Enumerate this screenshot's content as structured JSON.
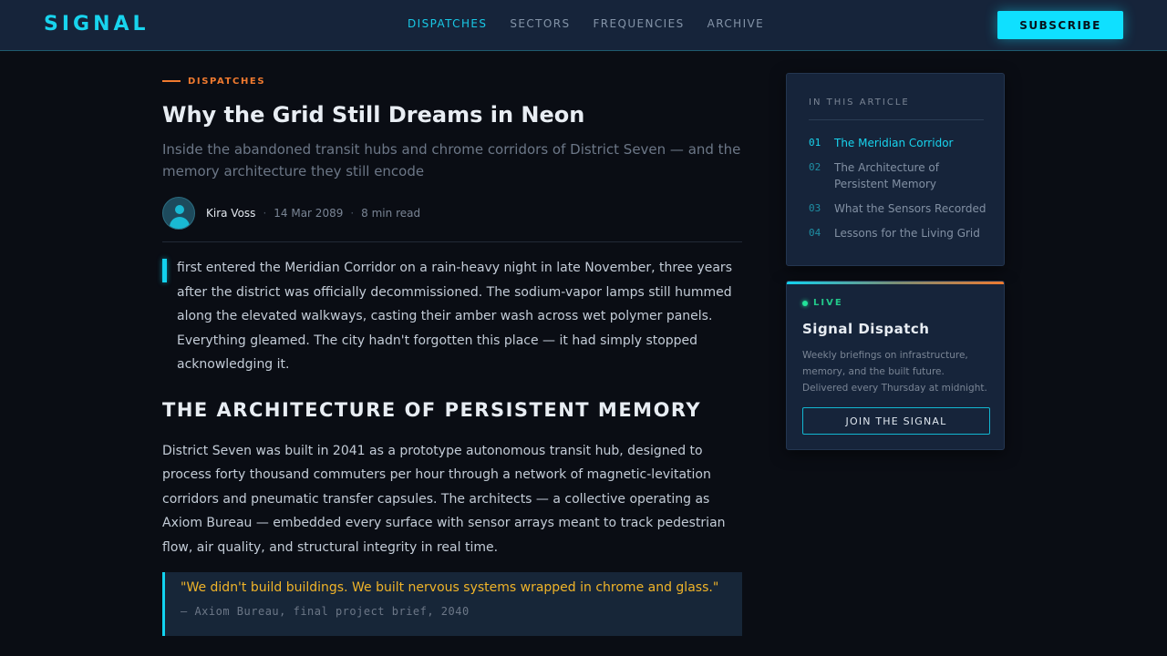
{
  "header": {
    "logo": "SIGNAL",
    "nav": [
      "DISPATCHES",
      "SECTORS",
      "FREQUENCIES",
      "ARCHIVE"
    ],
    "active_nav": "DISPATCHES",
    "subscribe_label": "SUBSCRIBE"
  },
  "article": {
    "kicker": "DISPATCHES",
    "title": "Why the Grid Still Dreams in Neon",
    "dek": "Inside the abandoned transit hubs and chrome corridors of District Seven — and the memory architecture they still encode",
    "author": "Kira Voss",
    "date": "14 Mar 2089",
    "read_time": "8 min read",
    "lead_paragraph": "first entered the Meridian Corridor on a rain-heavy night in late November, three years after the district was officially decommissioned. The sodium-vapor lamps still hummed along the elevated walkways, casting their amber wash across wet polymer panels. Everything gleamed. The city hadn't forgotten this place — it had simply stopped acknowledging it.",
    "section_heading": "THE ARCHITECTURE OF PERSISTENT MEMORY",
    "paragraph_2": "District Seven was built in 2041 as a prototype autonomous transit hub, designed to process forty thousand commuters per hour through a network of magnetic-levitation corridors and pneumatic transfer capsules. The architects — a collective operating as Axiom Bureau — embedded every surface with sensor arrays meant to track pedestrian flow, air quality, and structural integrity in real time.",
    "quote": "\"We didn't build buildings. We built nervous systems wrapped in chrome and glass.\"",
    "quote_source": "— Axiom Bureau, final project brief, 2040"
  },
  "toc": {
    "label": "IN THIS ARTICLE",
    "items": [
      {
        "num": "01",
        "title": "The Meridian Corridor",
        "active": true
      },
      {
        "num": "02",
        "title": "The Architecture of Persistent Memory",
        "active": false
      },
      {
        "num": "03",
        "title": "What the Sensors Recorded",
        "active": false
      },
      {
        "num": "04",
        "title": "Lessons for the Living Grid",
        "active": false
      }
    ]
  },
  "newsletter": {
    "status": "LIVE",
    "heading": "Signal Dispatch",
    "description": "Weekly briefings on infrastructure, memory, and the built future. Delivered every Thursday at midnight.",
    "button_label": "JOIN THE SIGNAL"
  },
  "colors": {
    "accent_cyan": "#12d2ef",
    "accent_orange": "#f07a2f",
    "quote_gold": "#f0b429",
    "live_green": "#22e39a",
    "background": "#0a0d14",
    "panel": "#16243a"
  }
}
